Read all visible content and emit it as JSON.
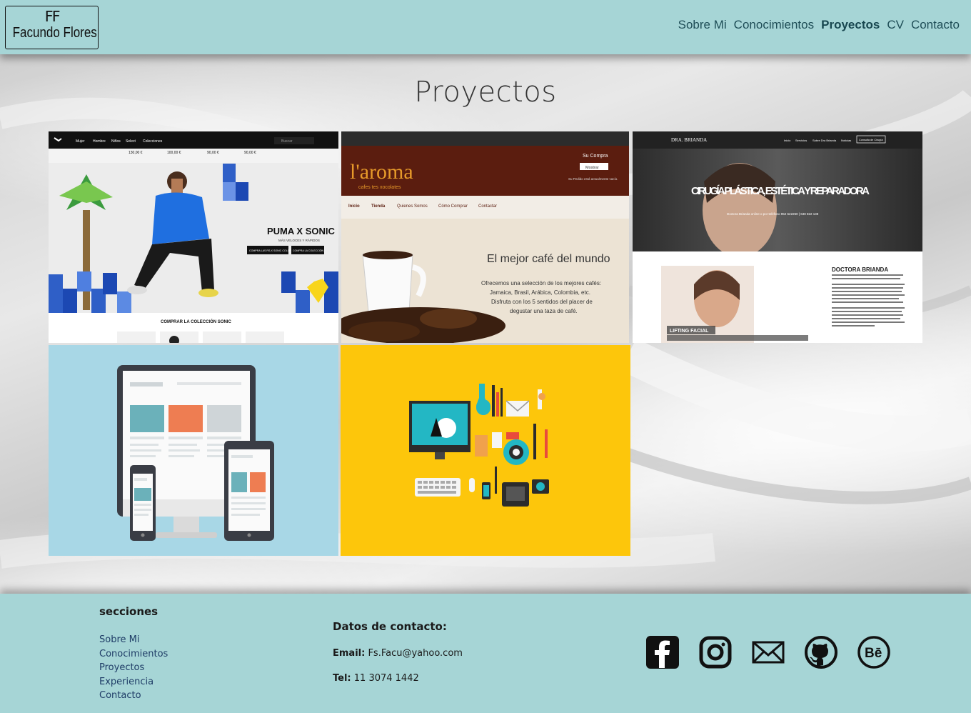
{
  "header": {
    "logo_mono": "FF",
    "logo_name": "Facundo Flores",
    "nav": [
      {
        "label": "Sobre Mi",
        "active": false
      },
      {
        "label": "Conocimientos",
        "active": false
      },
      {
        "label": "Proyectos",
        "active": true
      },
      {
        "label": "CV",
        "active": false
      },
      {
        "label": "Contacto",
        "active": false
      }
    ]
  },
  "main": {
    "title": "Proyectos",
    "projects": [
      {
        "nav_items": [
          "Mujer",
          "Hombre",
          "Niños",
          "Select",
          "Colecciones"
        ],
        "search_placeholder": "Buscar",
        "prices": [
          "130,00 €",
          "100,00 €",
          "90,00 €",
          "90,00 €"
        ],
        "headline": "PUMA X SONIC",
        "subline": "MÁS VELOCES Y RÁPIDOS",
        "btn1": "COMPRA LAS RS-X SONIC COLOR",
        "btn2": "COMPRA LA COLECCIÓN",
        "footer_text": "COMPRAR LA COLECCIÓN SONIC"
      },
      {
        "brand": "l'aroma",
        "brand_sub": "cafes tes xocolates",
        "cart_title": "Su Compra",
        "cart_button": "Mostrar",
        "cart_text": "Su Pedido está actualmente vacío.",
        "menu": [
          "Inicio",
          "Tienda",
          "Quienes Somos",
          "Cómo Comprar",
          "Contactar"
        ],
        "headline": "El mejor café del mundo",
        "body": [
          "Ofrecemos una selección de los mejores cafés:",
          "Jamaica, Brasil, Arábica, Colombia, etc.",
          "Disfruta con los 5 sentidos del placer de",
          "degustar una taza de café."
        ]
      },
      {
        "brand": "DRA. BRIANDA",
        "menu": [
          "Inicio",
          "Servicios",
          "Sobre Dra Brianda",
          "Noticias"
        ],
        "cta": "Consulta de Cirugía",
        "headline": "CIRUGÍA PLÁSTICA, ESTÉTICA Y REPARADORA",
        "subline": "Doctora Brianda online o por teléfono 952 622260 | 638 822 138",
        "section_title": "DOCTORA BRIANDA",
        "tag": "LIFTING FACIAL"
      },
      {},
      {}
    ]
  },
  "footer": {
    "sections_title": "secciones",
    "links": [
      "Sobre Mi",
      "Conocimientos",
      "Proyectos",
      "Experiencia",
      "Contacto"
    ],
    "contact_title": "Datos de contacto:",
    "email_label": "Email:",
    "email": "Fs.Facu@yahoo.com",
    "tel_label": "Tel:",
    "tel": "11 3074 1442",
    "social_icons": [
      "facebook-icon",
      "instagram-icon",
      "mail-icon",
      "github-icon",
      "behance-icon"
    ]
  },
  "colors": {
    "header_bg": "#a6d5d6",
    "nav_text": "#1f4e57",
    "tile_blue": "#a8d7e6",
    "tile_yellow": "#fdc60b"
  }
}
